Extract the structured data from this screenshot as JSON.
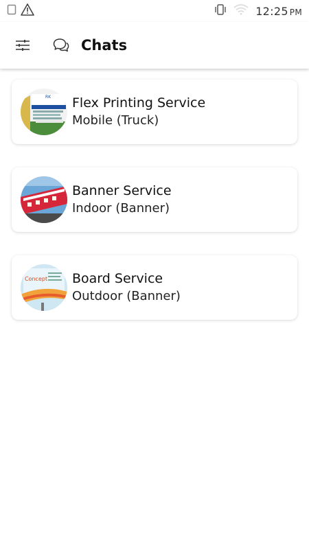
{
  "status_bar": {
    "time": "12:25",
    "ampm": "PM"
  },
  "app_bar": {
    "title": "Chats"
  },
  "chats": [
    {
      "title": "Flex Printing Service",
      "subtitle": "Mobile (Truck)"
    },
    {
      "title": "Banner Service",
      "subtitle": "Indoor (Banner)"
    },
    {
      "title": "Board Service",
      "subtitle": "Outdoor (Banner)"
    }
  ],
  "colors": {
    "background": "#ffffff",
    "card": "#ffffff",
    "text": "#111111"
  }
}
